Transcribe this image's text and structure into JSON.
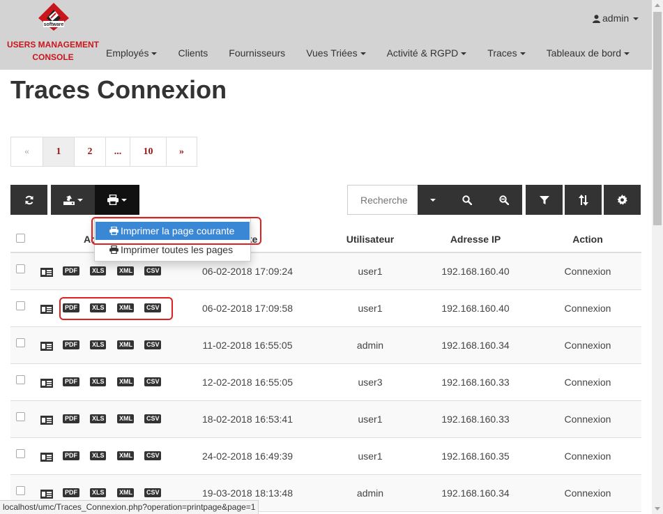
{
  "brand": {
    "logo_text": "software",
    "line1": "USERS MANAGEMENT",
    "line2": "CONSOLE"
  },
  "nav": {
    "items": [
      {
        "label": "Employés",
        "dropdown": true
      },
      {
        "label": "Clients",
        "dropdown": false
      },
      {
        "label": "Fournisseurs",
        "dropdown": false
      },
      {
        "label": "Vues Triées",
        "dropdown": true
      },
      {
        "label": "Activité & RGPD",
        "dropdown": true
      },
      {
        "label": "Traces",
        "dropdown": true
      },
      {
        "label": "Tableaux de bord",
        "dropdown": true
      }
    ],
    "user": "admin"
  },
  "page": {
    "title": "Traces Connexion"
  },
  "pagination": {
    "prev": "«",
    "pages": [
      "1",
      "2",
      "...",
      "10"
    ],
    "next": "»",
    "active": "1"
  },
  "search": {
    "placeholder": "Recherche"
  },
  "dropdown": {
    "print_current": "Imprimer la page courante",
    "print_all": "Imprimer toutes les pages"
  },
  "table": {
    "columns": {
      "actions": "Ac",
      "date_tail": "te",
      "user": "Utilisateur",
      "ip": "Adresse IP",
      "action": "Action"
    },
    "export_labels": [
      "PDF",
      "XLS",
      "XML",
      "CSV"
    ],
    "rows": [
      {
        "date": "06-02-2018 17:09:24",
        "user": "user1",
        "ip": "192.168.160.40",
        "action": "Connexion"
      },
      {
        "date": "06-02-2018 17:09:58",
        "user": "user1",
        "ip": "192.168.160.40",
        "action": "Connexion"
      },
      {
        "date": "11-02-2018 16:55:05",
        "user": "admin",
        "ip": "192.168.160.34",
        "action": "Connexion"
      },
      {
        "date": "12-02-2018 16:55:05",
        "user": "user3",
        "ip": "192.168.160.33",
        "action": "Connexion"
      },
      {
        "date": "18-02-2018 16:53:41",
        "user": "user1",
        "ip": "192.168.160.33",
        "action": "Connexion"
      },
      {
        "date": "24-02-2018 16:49:39",
        "user": "user1",
        "ip": "192.168.160.35",
        "action": "Connexion"
      },
      {
        "date": "19-03-2018 18:13:48",
        "user": "admin",
        "ip": "192.168.160.34",
        "action": "Connexion"
      }
    ]
  },
  "status_url": "localhost/umc/Traces_Connexion.php?operation=printpage&page=1",
  "colors": {
    "navbar": "#d3d3d3",
    "brand_red": "#c9161d",
    "button_dark": "#333333",
    "hover_blue": "#3a87d6",
    "highlight_red": "#e02020"
  }
}
